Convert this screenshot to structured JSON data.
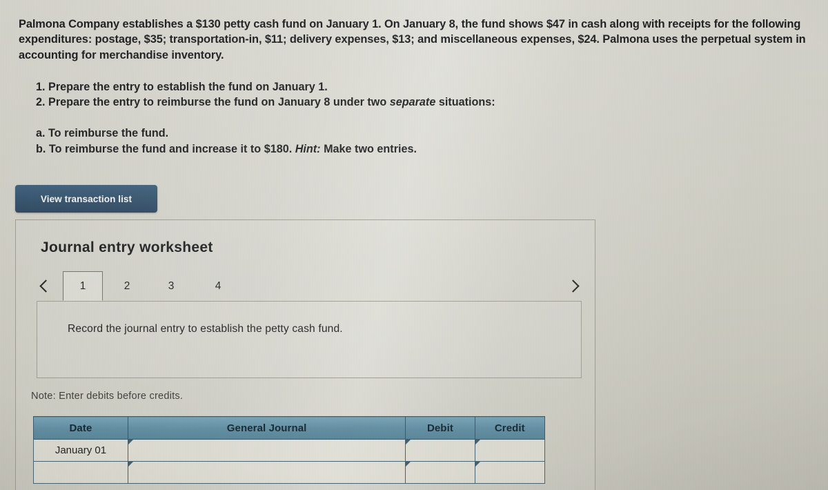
{
  "problem": {
    "statement": "Palmona Company establishes a $130 petty cash fund on January 1. On January 8, the fund shows $47 in cash along with receipts for the following expenditures: postage, $35; transportation-in, $11; delivery expenses, $13; and miscellaneous expenses, $24. Palmona uses the perpetual system in accounting for merchandise inventory."
  },
  "requirements": {
    "item1_num": "1.",
    "item1_text": "Prepare the entry to establish the fund on January 1.",
    "item2_num": "2.",
    "item2_text_before": "Prepare the entry to reimburse the fund on January 8 under two",
    "item2_italic": "separate",
    "item2_text_after": "situations:",
    "item_a": "a. To reimburse the fund.",
    "item_b_before": "b. To reimburse the fund and increase it to $180.",
    "item_b_italic": "Hint:",
    "item_b_after": "Make two entries."
  },
  "toolbar": {
    "view_transaction_list_label": "View transaction list"
  },
  "worksheet": {
    "title": "Journal entry worksheet",
    "prev_icon": "chevron-left-icon",
    "next_icon": "chevron-right-icon",
    "tabs": [
      {
        "label": "1",
        "active": true
      },
      {
        "label": "2",
        "active": false
      },
      {
        "label": "3",
        "active": false
      },
      {
        "label": "4",
        "active": false
      }
    ],
    "active_tab": "1",
    "record_instruction": "Record the journal entry to establish the petty cash fund.",
    "note": "Note: Enter debits before credits.",
    "table": {
      "headers": [
        "Date",
        "General Journal",
        "Debit",
        "Credit"
      ],
      "rows": [
        {
          "date": "January 01",
          "general_journal": "",
          "debit": "",
          "credit": ""
        },
        {
          "date": "",
          "general_journal": "",
          "debit": "",
          "credit": ""
        }
      ]
    }
  },
  "colors": {
    "button_navy": "#2d4c67",
    "table_header_blue": "#5f8da3",
    "page_background": "#cecdc3",
    "text_dark": "#16181a"
  }
}
